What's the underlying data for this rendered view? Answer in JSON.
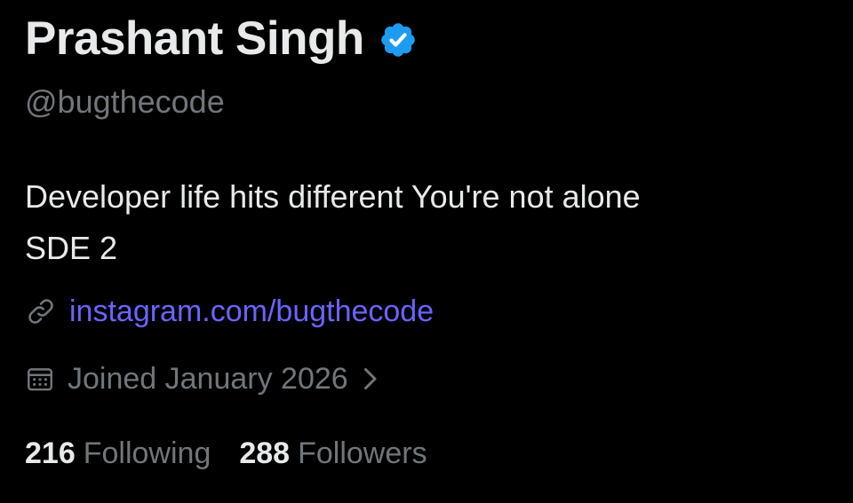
{
  "profile": {
    "display_name": "Prashant Singh",
    "verified": true,
    "handle": "@bugthecode",
    "bio_lines": [
      "Developer life hits different You're not alone",
      "SDE 2"
    ],
    "website": "instagram.com/bugthecode",
    "joined": "Joined January 2026",
    "stats": {
      "following_count": "216",
      "following_label": "Following",
      "followers_count": "288",
      "followers_label": "Followers"
    }
  },
  "icons": {
    "verified": "verified-badge-icon",
    "link": "link-icon",
    "calendar": "calendar-icon",
    "chevron": "chevron-right-icon"
  },
  "colors": {
    "background": "#000000",
    "primary_text": "#e7e9ea",
    "secondary_text": "#71767b",
    "link": "#6b63ff",
    "verified_badge": "#1d9bf0"
  }
}
